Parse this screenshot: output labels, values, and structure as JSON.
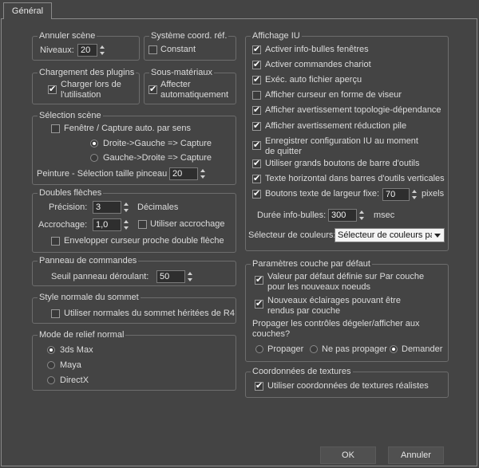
{
  "tab": {
    "label": "Général"
  },
  "undo": {
    "title": "Annuler scène",
    "levels_label": "Niveaux:",
    "levels_value": "20"
  },
  "coord_system": {
    "title": "Système coord. réf.",
    "constant_label": "Constant"
  },
  "plugin_loading": {
    "title": "Chargement des plugins",
    "load_on_use_label": "Charger lors de l'utilisation"
  },
  "sub_materials": {
    "title": "Sous-matériaux",
    "auto_assign_label": "Affecter automatiquement"
  },
  "scene_selection": {
    "title": "Sélection scène",
    "auto_window_label": "Fenêtre / Capture auto. par sens",
    "right_left_label": "Droite->Gauche => Capture",
    "left_right_label": "Gauche->Droite => Capture",
    "brush_size_label": "Peinture - Sélection taille pinceau",
    "brush_size_value": "20"
  },
  "double_arrows": {
    "title": "Doubles flèches",
    "precision_label": "Précision:",
    "precision_value": "3",
    "decimals_label": "Décimales",
    "snap_label": "Accrochage:",
    "snap_value": "1,0",
    "use_snap_label": "Utiliser accrochage",
    "wrap_cursor_label": "Envelopper curseur proche double flèche"
  },
  "command_panel": {
    "title": "Panneau de commandes",
    "rollout_label": "Seuil panneau déroulant:",
    "rollout_value": "50"
  },
  "vertex_normal": {
    "title": "Style normale du sommet",
    "legacy_label": "Utiliser normales du sommet héritées de R4"
  },
  "bump_mode": {
    "title": "Mode de relief normal",
    "options": [
      "3ds Max",
      "Maya",
      "DirectX"
    ]
  },
  "ui_display": {
    "title": "Affichage IU",
    "items": [
      "Activer info-bulles fenêtres",
      "Activer commandes chariot",
      "Exéc. auto fichier aperçu",
      "Afficher curseur en forme de viseur",
      "Afficher avertissement topologie-dépendance",
      "Afficher avertissement réduction pile",
      "Enregistrer configuration IU au moment de quitter",
      "Utiliser grands boutons de barre d'outils",
      "Texte horizontal dans barres d'outils verticales",
      "Boutons texte de largeur fixe:"
    ],
    "fixed_width_value": "70",
    "pixels_label": "pixels",
    "tooltip_delay_label": "Durée info-bulles:",
    "tooltip_delay_value": "300",
    "msec_label": "msec",
    "color_selector_label": "Sélecteur de couleurs:",
    "color_selector_value": "Sélecteur de couleurs par"
  },
  "layer_defaults": {
    "title": "Paramètres couche par défaut",
    "by_layer_label": "Valeur par défaut définie sur Par couche pour les nouveaux noeuds",
    "new_lights_label": "Nouveaux éclairages pouvant être rendus par couche",
    "propagate_question": "Propager les contrôles dégeler/afficher aux couches?",
    "propagate_options": [
      "Propager",
      "Ne pas propager",
      "Demander"
    ]
  },
  "texture_coords": {
    "title": "Coordonnées de textures",
    "real_world_label": "Utiliser coordonnées de textures réalistes"
  },
  "buttons": {
    "ok": "OK",
    "cancel": "Annuler"
  }
}
